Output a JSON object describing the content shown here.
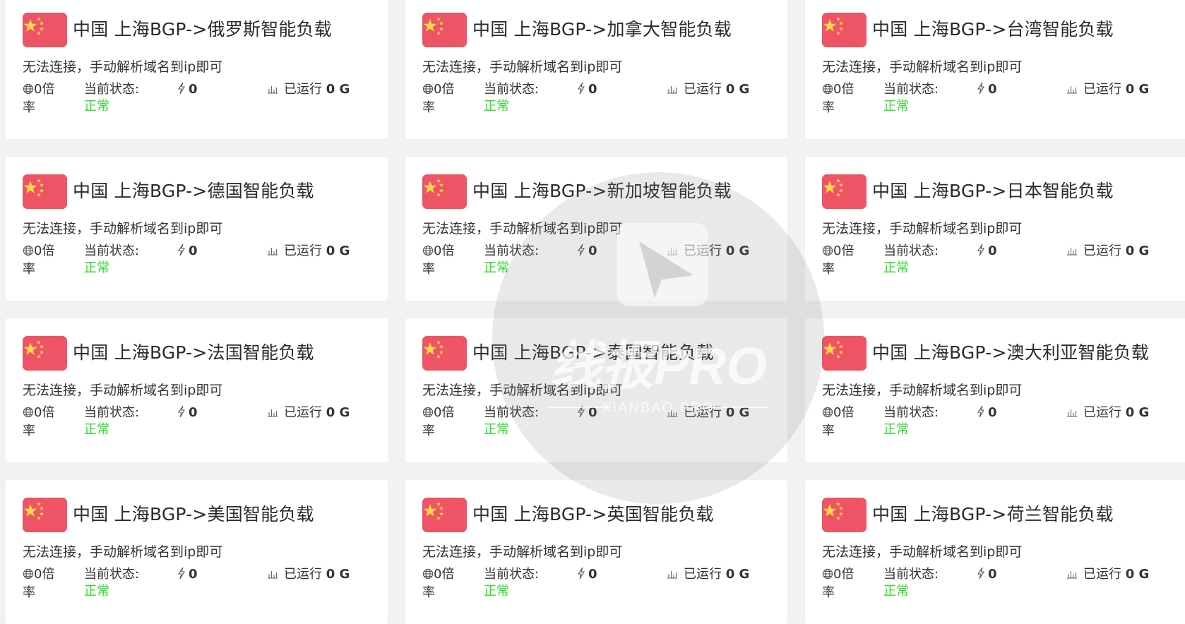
{
  "cards": [
    {
      "title": "中国 上海BGP->俄罗斯智能负载",
      "desc": "无法连接，手动解析域名到ip即可",
      "rate": "0倍率",
      "status_label": "当前状态:",
      "status_value": "正常",
      "speed": "0",
      "run_label": "已运行",
      "run_value": "0 G"
    },
    {
      "title": "中国 上海BGP->加拿大智能负载",
      "desc": "无法连接，手动解析域名到ip即可",
      "rate": "0倍率",
      "status_label": "当前状态:",
      "status_value": "正常",
      "speed": "0",
      "run_label": "已运行",
      "run_value": "0 G"
    },
    {
      "title": "中国 上海BGP->台湾智能负载",
      "desc": "无法连接，手动解析域名到ip即可",
      "rate": "0倍率",
      "status_label": "当前状态:",
      "status_value": "正常",
      "speed": "0",
      "run_label": "已运行",
      "run_value": "0 G"
    },
    {
      "title": "中国 上海BGP->德国智能负载",
      "desc": "无法连接，手动解析域名到ip即可",
      "rate": "0倍率",
      "status_label": "当前状态:",
      "status_value": "正常",
      "speed": "0",
      "run_label": "已运行",
      "run_value": "0 G"
    },
    {
      "title": "中国 上海BGP->新加坡智能负载",
      "desc": "无法连接，手动解析域名到ip即可",
      "rate": "0倍率",
      "status_label": "当前状态:",
      "status_value": "正常",
      "speed": "0",
      "run_label": "已运行",
      "run_value": "0 G"
    },
    {
      "title": "中国 上海BGP->日本智能负载",
      "desc": "无法连接，手动解析域名到ip即可",
      "rate": "0倍率",
      "status_label": "当前状态:",
      "status_value": "正常",
      "speed": "0",
      "run_label": "已运行",
      "run_value": "0 G"
    },
    {
      "title": "中国 上海BGP->法国智能负载",
      "desc": "无法连接，手动解析域名到ip即可",
      "rate": "0倍率",
      "status_label": "当前状态:",
      "status_value": "正常",
      "speed": "0",
      "run_label": "已运行",
      "run_value": "0 G"
    },
    {
      "title": "中国 上海BGP->泰国智能负载",
      "desc": "无法连接，手动解析域名到ip即可",
      "rate": "0倍率",
      "status_label": "当前状态:",
      "status_value": "正常",
      "speed": "0",
      "run_label": "已运行",
      "run_value": "0 G"
    },
    {
      "title": "中国 上海BGP->澳大利亚智能负载",
      "desc": "无法连接，手动解析域名到ip即可",
      "rate": "0倍率",
      "status_label": "当前状态:",
      "status_value": "正常",
      "speed": "0",
      "run_label": "已运行",
      "run_value": "0 G"
    },
    {
      "title": "中国 上海BGP->美国智能负载",
      "desc": "无法连接，手动解析域名到ip即可",
      "rate": "0倍率",
      "status_label": "当前状态:",
      "status_value": "正常",
      "speed": "0",
      "run_label": "已运行",
      "run_value": "0 G"
    },
    {
      "title": "中国 上海BGP->英国智能负载",
      "desc": "无法连接，手动解析域名到ip即可",
      "rate": "0倍率",
      "status_label": "当前状态:",
      "status_value": "正常",
      "speed": "0",
      "run_label": "已运行",
      "run_value": "0 G"
    },
    {
      "title": "中国 上海BGP->荷兰智能负载",
      "desc": "无法连接，手动解析域名到ip即可",
      "rate": "0倍率",
      "status_label": "当前状态:",
      "status_value": "正常",
      "speed": "0",
      "run_label": "已运行",
      "run_value": "0 G"
    }
  ],
  "icons": {
    "flag": "china-flag-icon",
    "rate": "globe-icon",
    "speed": "lightning-icon",
    "run": "bar-chart-icon"
  },
  "colors": {
    "flag_red": "#ee5466",
    "flag_star": "#ffd54a",
    "status_ok": "#2ee02e",
    "page_bg": "#f2f2f2",
    "card_bg": "#ffffff"
  },
  "watermark": {
    "brand": "线报PRO",
    "site": "XIANBAO.PRO"
  }
}
